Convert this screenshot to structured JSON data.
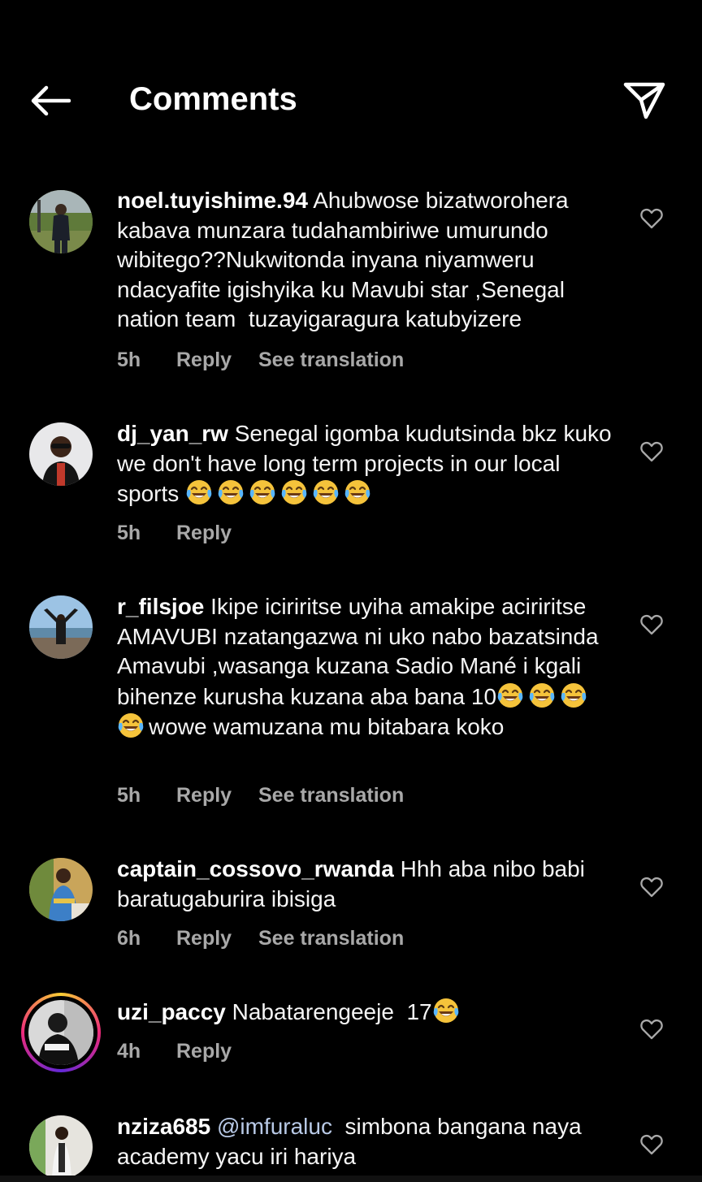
{
  "header": {
    "title": "Comments",
    "back_icon": "arrow-left-icon",
    "share_icon": "paper-plane-icon"
  },
  "comments": [
    {
      "username": "noel.tuyishime.94",
      "text": "Ahubwose bizatworohera kabava munzara tudahambiriwe umurundo wibitego??Nukwitonda inyana niyamweru ndacyafite igishyika ku Mavubi star ,Senegal nation team  tuzayigaragura katubyizere",
      "time": "5h",
      "reply": "Reply",
      "translation": "See translation"
    },
    {
      "username": "dj_yan_rw",
      "text": "Senegal igomba kudutsinda bkz kuko we don't have long term projects in our local sports ",
      "emojis": 6,
      "time": "5h",
      "reply": "Reply"
    },
    {
      "username": "r_filsjoe",
      "text": "Ikipe iciriritse uyiha amakipe aciriritse AMAVUBI nzatangazwa ni uko nabo bazatsinda Amavubi ,wasanga kuzana Sadio Mané i kgali bihenze kurusha kuzana aba bana 10",
      "emojis": 4,
      "text_after": "wowe wamuzana mu bitabara koko",
      "time": "5h",
      "reply": "Reply",
      "translation": "See translation"
    },
    {
      "username": "captain_cossovo_rwanda",
      "text": "Hhh aba nibo babi baratugaburira ibisiga",
      "time": "6h",
      "reply": "Reply",
      "translation": "See translation"
    },
    {
      "username": "uzi_paccy",
      "text": "Nabatarengeeje  17",
      "emojis": 1,
      "time": "4h",
      "reply": "Reply"
    },
    {
      "username": "nziza685",
      "mention": "@imfuraluc",
      "text": "  simbona bangana naya academy yacu iri hariya"
    }
  ],
  "colors": {
    "background": "#000000",
    "text": "#f5f5f5",
    "meta": "#a8a8a8",
    "mention": "#b8c9e6",
    "story_ring": [
      "#f9ce34",
      "#ee2a7b",
      "#6228d7"
    ]
  },
  "icons": {
    "like": "heart-outline-icon",
    "emoji": "face-with-tears-of-joy-icon"
  }
}
